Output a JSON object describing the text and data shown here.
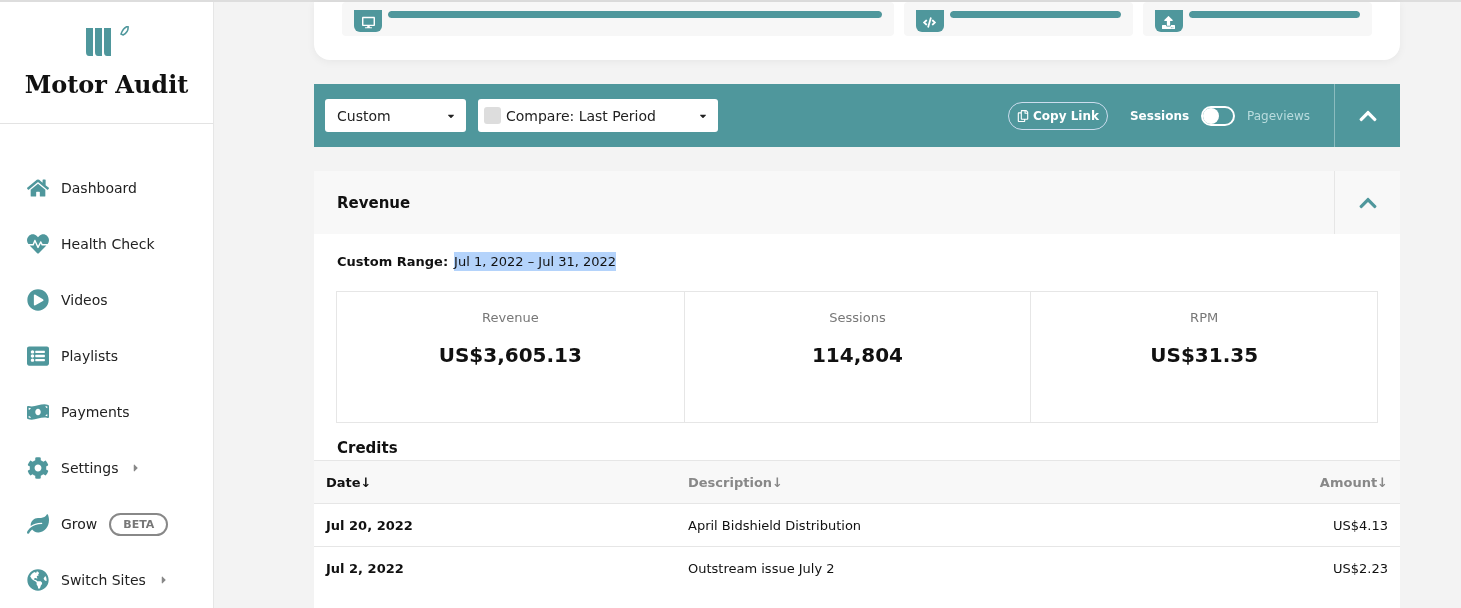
{
  "sidebar": {
    "brand": "Motor Audit",
    "items": [
      {
        "kind": "home",
        "label": "Dashboard",
        "submenu": false
      },
      {
        "kind": "heart",
        "label": "Health Check",
        "submenu": false
      },
      {
        "kind": "play",
        "label": "Videos",
        "submenu": false
      },
      {
        "kind": "list",
        "label": "Playlists",
        "submenu": false
      },
      {
        "kind": "money",
        "label": "Payments",
        "submenu": false
      },
      {
        "kind": "gear",
        "label": "Settings",
        "submenu": true
      },
      {
        "kind": "leaf",
        "label": "Grow",
        "submenu": false,
        "badge": "BETA"
      },
      {
        "kind": "globe",
        "label": "Switch Sites",
        "submenu": true
      }
    ]
  },
  "top_card": {
    "tiles": [
      {
        "kind": "monitor",
        "level": 1
      },
      {
        "kind": "code",
        "level": 1
      },
      {
        "kind": "upload",
        "level": 1
      }
    ]
  },
  "filter_bar": {
    "range": "Custom",
    "compare": "Compare: Last Period",
    "copy_link": "Copy Link",
    "toggle": [
      {
        "label": "Sessions",
        "selected": true
      },
      {
        "label": "Pageviews",
        "selected": false
      }
    ],
    "switch_on": false
  },
  "revenue": {
    "title": "Revenue",
    "range_label": "Custom Range:",
    "range_value": "Jul 1, 2022 – Jul 31, 2022",
    "stats": [
      {
        "label": "Revenue",
        "value": "US$3,605.13"
      },
      {
        "label": "Sessions",
        "value": "114,804"
      },
      {
        "label": "RPM",
        "value": "US$31.35"
      }
    ],
    "credits": {
      "title": "Credits",
      "columns": [
        {
          "label": "Date↓",
          "selected": true
        },
        {
          "label": "Description↓",
          "selected": false
        },
        {
          "label": "Amount↓",
          "selected": false
        }
      ],
      "rows": [
        [
          "Jul 20, 2022",
          "April Bidshield Distribution",
          "US$4.13"
        ],
        [
          "Jul 2, 2022",
          "Outstream issue July 2",
          "US$2.23"
        ]
      ]
    }
  }
}
